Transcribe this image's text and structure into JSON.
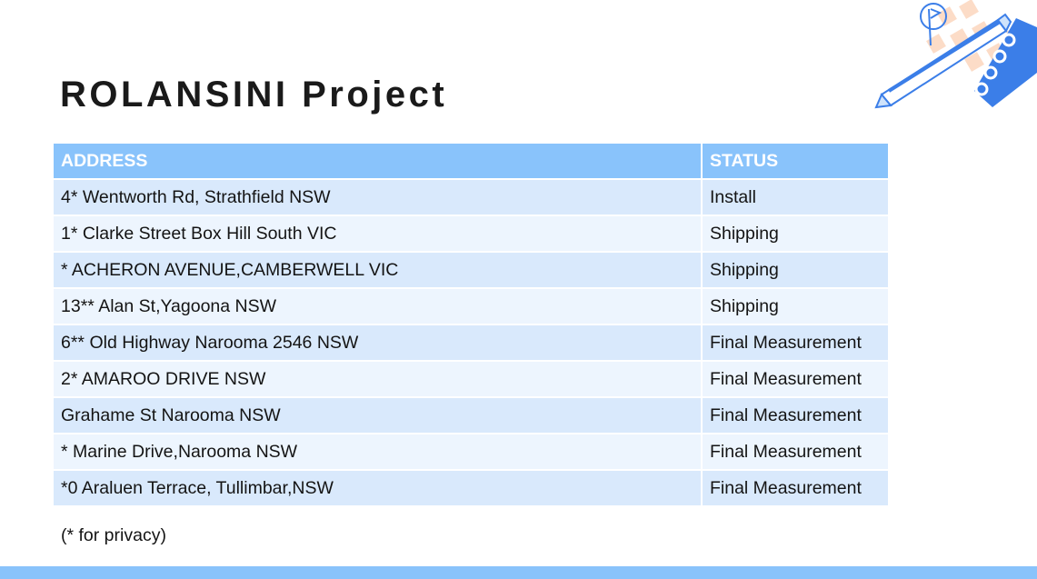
{
  "slide": {
    "title": "ROLANSINI Project",
    "footnote": "(* for privacy)"
  },
  "table": {
    "headers": {
      "address": "ADDRESS",
      "status": "STATUS"
    },
    "rows": [
      {
        "address": "4* Wentworth Rd, Strathfield NSW",
        "status": "Install"
      },
      {
        "address": "1* Clarke Street Box Hill South VIC",
        "status": "Shipping"
      },
      {
        "address": "* ACHERON AVENUE,CAMBERWELL VIC",
        "status": "Shipping"
      },
      {
        "address": "13** Alan St,Yagoona NSW",
        "status": "Shipping"
      },
      {
        "address": "6** Old Highway Narooma 2546 NSW",
        "status": "Final Measurement"
      },
      {
        "address": "2* AMAROO DRIVE NSW",
        "status": "Final Measurement"
      },
      {
        "address": "Grahame St Narooma NSW",
        "status": "Final Measurement"
      },
      {
        "address": "* Marine Drive,Narooma NSW",
        "status": "Final Measurement"
      },
      {
        "address": "*0 Araluen Terrace, Tullimbar,NSW",
        "status": "Final Measurement"
      }
    ]
  },
  "decoration": {
    "icons": [
      "graph-paper-icon",
      "pin-icon",
      "pencil-icon",
      "spiral-notebook-icon"
    ],
    "colors": {
      "accent_blue": "#89c3fb",
      "icon_blue": "#3b7ee8",
      "peach": "#fcd6bd",
      "row_light": "#d9e9fc",
      "row_lighter": "#edf5fe"
    }
  }
}
